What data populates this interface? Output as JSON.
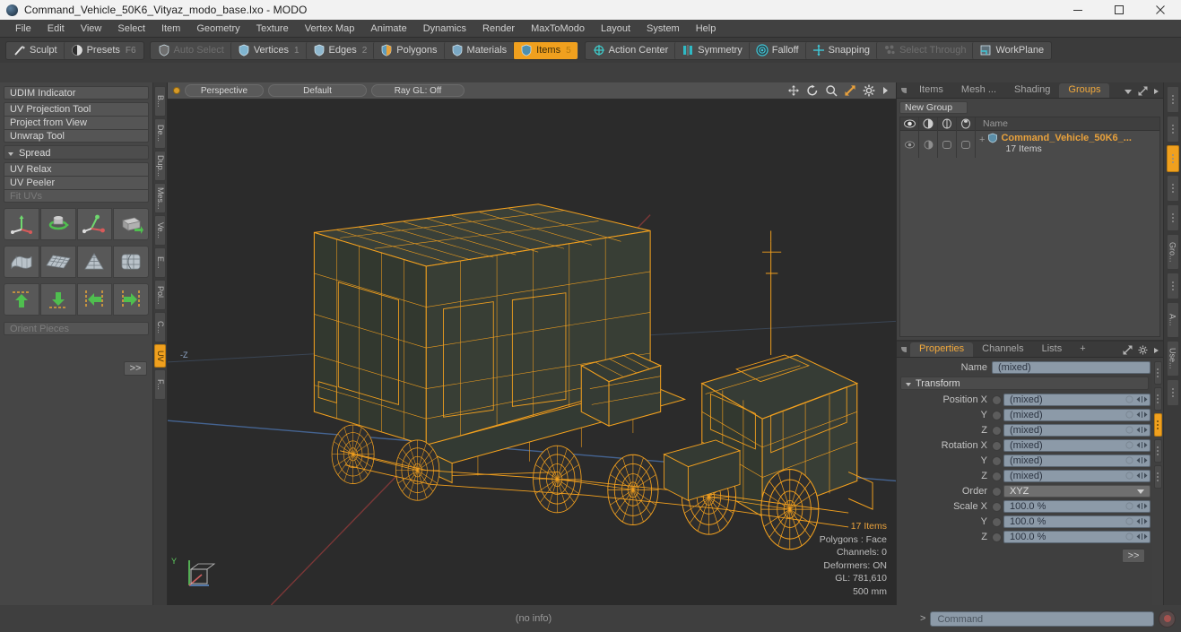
{
  "window": {
    "title": "Command_Vehicle_50K6_Vityaz_modo_base.lxo - MODO",
    "minimize": "—",
    "maximize": "☐",
    "close": "✕"
  },
  "menubar": {
    "items": [
      "File",
      "Edit",
      "View",
      "Select",
      "Item",
      "Geometry",
      "Texture",
      "Vertex Map",
      "Animate",
      "Dynamics",
      "Render",
      "MaxToModo",
      "Layout",
      "System",
      "Help"
    ]
  },
  "toolbar": {
    "group1": [
      {
        "label": "Sculpt",
        "icon": "brush-icon",
        "state": "normal",
        "num": ""
      },
      {
        "label": "Presets",
        "icon": "sphere-icon",
        "state": "normal",
        "num": "F6"
      }
    ],
    "group2": [
      {
        "label": "Auto Select",
        "icon": "shield-icon",
        "state": "disabled",
        "num": ""
      },
      {
        "label": "Vertices",
        "icon": "vertex-icon",
        "state": "normal",
        "num": "1"
      },
      {
        "label": "Edges",
        "icon": "edge-icon",
        "state": "normal",
        "num": "2"
      },
      {
        "label": "Polygons",
        "icon": "polygon-icon",
        "state": "normal",
        "num": ""
      },
      {
        "label": "Materials",
        "icon": "material-icon",
        "state": "normal",
        "num": ""
      },
      {
        "label": "Items",
        "icon": "items-icon",
        "state": "active",
        "num": "5"
      }
    ],
    "group3": [
      {
        "label": "Action Center",
        "icon": "action-center-icon",
        "state": "normal",
        "num": ""
      },
      {
        "label": "Symmetry",
        "icon": "symmetry-icon",
        "state": "normal",
        "num": ""
      },
      {
        "label": "Falloff",
        "icon": "falloff-icon",
        "state": "normal",
        "num": ""
      },
      {
        "label": "Snapping",
        "icon": "snapping-icon",
        "state": "normal",
        "num": ""
      },
      {
        "label": "Select Through",
        "icon": "select-through-icon",
        "state": "disabled",
        "num": ""
      },
      {
        "label": "WorkPlane",
        "icon": "workplane-icon",
        "state": "normal",
        "num": ""
      }
    ]
  },
  "left_panel": {
    "udim": "UDIM Indicator",
    "tools": [
      "UV Projection Tool",
      "Project from View",
      "Unwrap Tool"
    ],
    "spread_label": "Spread",
    "relax_tools": [
      {
        "label": "UV Relax",
        "dim": false
      },
      {
        "label": "UV Peeler",
        "dim": false
      },
      {
        "label": "Fit UVs",
        "dim": true
      }
    ],
    "icon_rows": [
      [
        "move-uv-icon",
        "rotate-uv-icon",
        "scale-uv-icon",
        "flip-uv-icon"
      ],
      [
        "uv-wrap-icon",
        "uv-grid-icon",
        "uv-cone-icon",
        "uv-sphere-icon"
      ],
      [
        "align-up-icon",
        "align-down-icon",
        "align-left-icon",
        "align-right-icon"
      ]
    ],
    "orient_pieces": "Orient Pieces",
    "more_label": ">>",
    "vtabs": [
      {
        "label": "B...",
        "active": false
      },
      {
        "label": "De...",
        "active": false
      },
      {
        "label": "Dup...",
        "active": false
      },
      {
        "label": "Mes...",
        "active": false
      },
      {
        "label": "Ve...",
        "active": false
      },
      {
        "label": "E...",
        "active": false
      },
      {
        "label": "Pol...",
        "active": false
      },
      {
        "label": "C...",
        "active": false
      },
      {
        "label": "UV",
        "active": true
      },
      {
        "label": "F...",
        "active": false
      }
    ]
  },
  "viewport": {
    "view_mode": "Perspective",
    "shading": "Default",
    "raygl": "Ray GL: Off",
    "tool_icons": [
      "pan-icon",
      "rotate-icon",
      "zoom-icon",
      "fit-icon",
      "gear-icon",
      "arrow-icon"
    ],
    "stats": [
      {
        "text": "17 Items",
        "highlight": true
      },
      {
        "text": "Polygons : Face",
        "highlight": false
      },
      {
        "text": "Channels: 0",
        "highlight": false
      },
      {
        "text": "Deformers: ON",
        "highlight": false
      },
      {
        "text": "GL: 781,610",
        "highlight": false
      },
      {
        "text": "500 mm",
        "highlight": false
      }
    ],
    "axis_y": "Y",
    "axis_z": "-Z"
  },
  "right_top": {
    "tabs": [
      {
        "label": "Items",
        "active": false
      },
      {
        "label": "Mesh ...",
        "active": false
      },
      {
        "label": "Shading",
        "active": false
      },
      {
        "label": "Groups",
        "active": true
      }
    ],
    "dropdown_icon": "chevron-down-icon",
    "expand_icon": "expand-icon",
    "arrow_icon": "arrow-right-icon",
    "new_group": "New Group",
    "columns": [
      "eye-icon",
      "render-icon",
      "wireframe-icon",
      "shade-icon"
    ],
    "name_header": "Name",
    "rows": [
      {
        "name": "Command_Vehicle_50K6_...",
        "sub": "17 Items",
        "icon": "group-icon"
      }
    ]
  },
  "properties": {
    "tabs": [
      {
        "label": "Properties",
        "active": true
      },
      {
        "label": "Channels",
        "active": false
      },
      {
        "label": "Lists",
        "active": false
      },
      {
        "label": "+",
        "active": false
      }
    ],
    "gear_icon": "gear-icon",
    "expand_icon": "expand-icon",
    "name_label": "Name",
    "name_value": "(mixed)",
    "transform_label": "Transform",
    "rows": [
      {
        "label": "Position X",
        "value": "(mixed)",
        "type": "field"
      },
      {
        "label": "Y",
        "value": "(mixed)",
        "type": "field"
      },
      {
        "label": "Z",
        "value": "(mixed)",
        "type": "field"
      },
      {
        "label": "Rotation X",
        "value": "(mixed)",
        "type": "field"
      },
      {
        "label": "Y",
        "value": "(mixed)",
        "type": "field"
      },
      {
        "label": "Z",
        "value": "(mixed)",
        "type": "field"
      },
      {
        "label": "Order",
        "value": "XYZ",
        "type": "dropdown"
      },
      {
        "label": "Scale X",
        "value": "100.0 %",
        "type": "field"
      },
      {
        "label": "Y",
        "value": "100.0 %",
        "type": "field"
      },
      {
        "label": "Z",
        "value": "100.0 %",
        "type": "field"
      }
    ],
    "more_label": ">>",
    "vtabs": [
      {
        "label": "",
        "active": false,
        "dots": true
      },
      {
        "label": "",
        "active": false,
        "dots": true
      },
      {
        "label": "",
        "active": true,
        "dots": true
      },
      {
        "label": "",
        "active": false,
        "dots": true
      },
      {
        "label": "",
        "active": false,
        "dots": true
      },
      {
        "label": "Gro...",
        "active": false,
        "dots": false
      },
      {
        "label": "",
        "active": false,
        "dots": true
      },
      {
        "label": "A...",
        "active": false,
        "dots": false
      },
      {
        "label": "Use...",
        "active": false,
        "dots": false
      },
      {
        "label": "",
        "active": false,
        "dots": true
      }
    ]
  },
  "statusbar": {
    "info": "(no info)",
    "prompt": ">",
    "command_placeholder": "Command",
    "record_icon": "record-icon"
  },
  "colors": {
    "accent": "#f0a01e",
    "model_wire": "#f4a11e",
    "panel_bg": "#434343",
    "viewport_bg": "#2b2b2b",
    "field_bg": "#8c9aa8"
  }
}
